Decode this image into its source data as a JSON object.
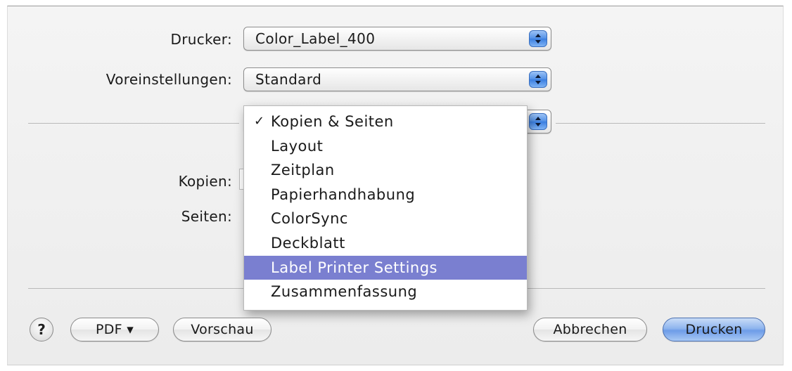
{
  "printer": {
    "label": "Drucker:",
    "value": "Color_Label_400"
  },
  "presets": {
    "label": "Voreinstellungen:",
    "value": "Standard"
  },
  "copies": {
    "label": "Kopien:"
  },
  "pages": {
    "label": "Seiten:"
  },
  "section_menu": {
    "checked_index": 0,
    "selected_index": 6,
    "check_glyph": "✓",
    "items": [
      "Kopien & Seiten",
      "Layout",
      "Zeitplan",
      "Papierhandhabung",
      "ColorSync",
      "Deckblatt",
      "Label Printer Settings",
      "Zusammenfassung"
    ]
  },
  "buttons": {
    "help": "?",
    "pdf": "PDF ▾",
    "preview": "Vorschau",
    "cancel": "Abbrechen",
    "print": "Drucken"
  },
  "colors": {
    "menu_highlight": "#7a7fd0",
    "default_button": "#6d9ce8"
  }
}
